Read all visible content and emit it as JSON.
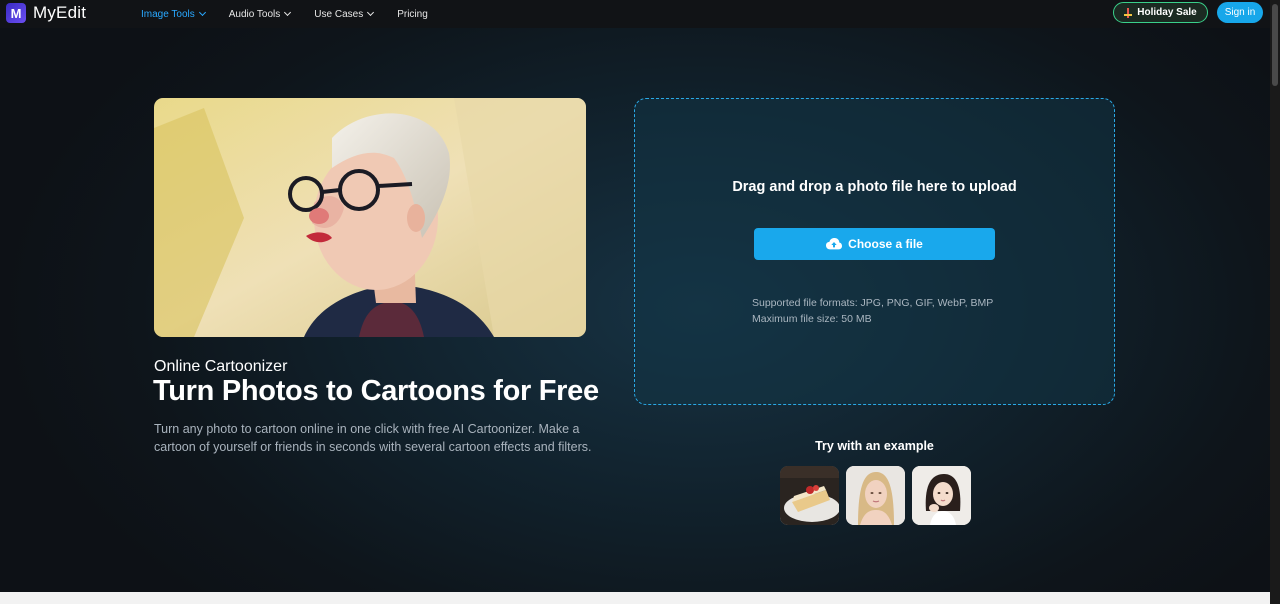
{
  "nav": {
    "logo_letter": "M",
    "logo_text": "MyEdit",
    "menu": [
      {
        "label": "Image Tools",
        "active": true,
        "has_dropdown": true
      },
      {
        "label": "Audio Tools",
        "active": false,
        "has_dropdown": true
      },
      {
        "label": "Use Cases",
        "active": false,
        "has_dropdown": true
      },
      {
        "label": "Pricing",
        "active": false,
        "has_dropdown": false
      }
    ],
    "holiday_label": "Holiday Sale",
    "signin_label": "Sign in"
  },
  "hero": {
    "image_icon": "cartoonized-portrait",
    "eyebrow": "Online Cartoonizer",
    "title": "Turn Photos to Cartoons for Free",
    "description": "Turn any photo to cartoon online in one click with free AI Cartoonizer. Make a cartoon of yourself or friends in seconds with several cartoon effects and filters."
  },
  "upload": {
    "title": "Drag and drop a photo file here to upload",
    "button_label": "Choose a file",
    "button_icon": "cloud-upload-icon",
    "formats_text": "Supported file formats: JPG, PNG, GIF, WebP, BMP",
    "max_size_text": "Maximum file size: 50 MB"
  },
  "examples": {
    "label": "Try with an example",
    "items": [
      {
        "icon": "cake-example"
      },
      {
        "icon": "blonde-woman-example"
      },
      {
        "icon": "dark-hair-woman-example"
      }
    ]
  },
  "colors": {
    "accent": "#19a8ec",
    "active_menu": "#29a8ff",
    "holiday_border": "#3ad08a",
    "background": "#0f1217"
  }
}
